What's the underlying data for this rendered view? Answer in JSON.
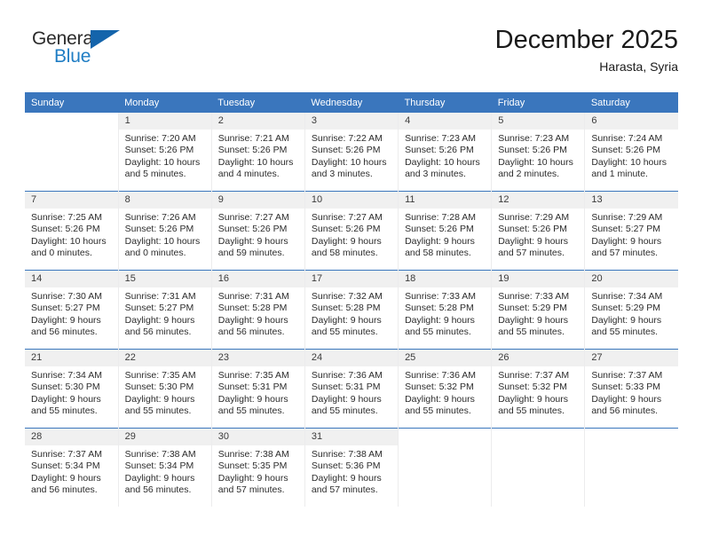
{
  "brand": {
    "name_part1": "General",
    "name_part2": "Blue",
    "triangle_color": "#1464ab",
    "blue_color": "#1f7dc4"
  },
  "header": {
    "title": "December 2025",
    "location": "Harasta, Syria",
    "header_bg": "#3a76bd",
    "daynum_bg": "#f0f0f0"
  },
  "weekdays": [
    "Sunday",
    "Monday",
    "Tuesday",
    "Wednesday",
    "Thursday",
    "Friday",
    "Saturday"
  ],
  "labels": {
    "sunrise": "Sunrise:",
    "sunset": "Sunset:",
    "daylight": "Daylight:"
  },
  "weeks": [
    [
      {
        "day": "",
        "sunrise": "",
        "sunset": "",
        "daylight": ""
      },
      {
        "day": "1",
        "sunrise": "Sunrise: 7:20 AM",
        "sunset": "Sunset: 5:26 PM",
        "daylight": "Daylight: 10 hours and 5 minutes."
      },
      {
        "day": "2",
        "sunrise": "Sunrise: 7:21 AM",
        "sunset": "Sunset: 5:26 PM",
        "daylight": "Daylight: 10 hours and 4 minutes."
      },
      {
        "day": "3",
        "sunrise": "Sunrise: 7:22 AM",
        "sunset": "Sunset: 5:26 PM",
        "daylight": "Daylight: 10 hours and 3 minutes."
      },
      {
        "day": "4",
        "sunrise": "Sunrise: 7:23 AM",
        "sunset": "Sunset: 5:26 PM",
        "daylight": "Daylight: 10 hours and 3 minutes."
      },
      {
        "day": "5",
        "sunrise": "Sunrise: 7:23 AM",
        "sunset": "Sunset: 5:26 PM",
        "daylight": "Daylight: 10 hours and 2 minutes."
      },
      {
        "day": "6",
        "sunrise": "Sunrise: 7:24 AM",
        "sunset": "Sunset: 5:26 PM",
        "daylight": "Daylight: 10 hours and 1 minute."
      }
    ],
    [
      {
        "day": "7",
        "sunrise": "Sunrise: 7:25 AM",
        "sunset": "Sunset: 5:26 PM",
        "daylight": "Daylight: 10 hours and 0 minutes."
      },
      {
        "day": "8",
        "sunrise": "Sunrise: 7:26 AM",
        "sunset": "Sunset: 5:26 PM",
        "daylight": "Daylight: 10 hours and 0 minutes."
      },
      {
        "day": "9",
        "sunrise": "Sunrise: 7:27 AM",
        "sunset": "Sunset: 5:26 PM",
        "daylight": "Daylight: 9 hours and 59 minutes."
      },
      {
        "day": "10",
        "sunrise": "Sunrise: 7:27 AM",
        "sunset": "Sunset: 5:26 PM",
        "daylight": "Daylight: 9 hours and 58 minutes."
      },
      {
        "day": "11",
        "sunrise": "Sunrise: 7:28 AM",
        "sunset": "Sunset: 5:26 PM",
        "daylight": "Daylight: 9 hours and 58 minutes."
      },
      {
        "day": "12",
        "sunrise": "Sunrise: 7:29 AM",
        "sunset": "Sunset: 5:26 PM",
        "daylight": "Daylight: 9 hours and 57 minutes."
      },
      {
        "day": "13",
        "sunrise": "Sunrise: 7:29 AM",
        "sunset": "Sunset: 5:27 PM",
        "daylight": "Daylight: 9 hours and 57 minutes."
      }
    ],
    [
      {
        "day": "14",
        "sunrise": "Sunrise: 7:30 AM",
        "sunset": "Sunset: 5:27 PM",
        "daylight": "Daylight: 9 hours and 56 minutes."
      },
      {
        "day": "15",
        "sunrise": "Sunrise: 7:31 AM",
        "sunset": "Sunset: 5:27 PM",
        "daylight": "Daylight: 9 hours and 56 minutes."
      },
      {
        "day": "16",
        "sunrise": "Sunrise: 7:31 AM",
        "sunset": "Sunset: 5:28 PM",
        "daylight": "Daylight: 9 hours and 56 minutes."
      },
      {
        "day": "17",
        "sunrise": "Sunrise: 7:32 AM",
        "sunset": "Sunset: 5:28 PM",
        "daylight": "Daylight: 9 hours and 55 minutes."
      },
      {
        "day": "18",
        "sunrise": "Sunrise: 7:33 AM",
        "sunset": "Sunset: 5:28 PM",
        "daylight": "Daylight: 9 hours and 55 minutes."
      },
      {
        "day": "19",
        "sunrise": "Sunrise: 7:33 AM",
        "sunset": "Sunset: 5:29 PM",
        "daylight": "Daylight: 9 hours and 55 minutes."
      },
      {
        "day": "20",
        "sunrise": "Sunrise: 7:34 AM",
        "sunset": "Sunset: 5:29 PM",
        "daylight": "Daylight: 9 hours and 55 minutes."
      }
    ],
    [
      {
        "day": "21",
        "sunrise": "Sunrise: 7:34 AM",
        "sunset": "Sunset: 5:30 PM",
        "daylight": "Daylight: 9 hours and 55 minutes."
      },
      {
        "day": "22",
        "sunrise": "Sunrise: 7:35 AM",
        "sunset": "Sunset: 5:30 PM",
        "daylight": "Daylight: 9 hours and 55 minutes."
      },
      {
        "day": "23",
        "sunrise": "Sunrise: 7:35 AM",
        "sunset": "Sunset: 5:31 PM",
        "daylight": "Daylight: 9 hours and 55 minutes."
      },
      {
        "day": "24",
        "sunrise": "Sunrise: 7:36 AM",
        "sunset": "Sunset: 5:31 PM",
        "daylight": "Daylight: 9 hours and 55 minutes."
      },
      {
        "day": "25",
        "sunrise": "Sunrise: 7:36 AM",
        "sunset": "Sunset: 5:32 PM",
        "daylight": "Daylight: 9 hours and 55 minutes."
      },
      {
        "day": "26",
        "sunrise": "Sunrise: 7:37 AM",
        "sunset": "Sunset: 5:32 PM",
        "daylight": "Daylight: 9 hours and 55 minutes."
      },
      {
        "day": "27",
        "sunrise": "Sunrise: 7:37 AM",
        "sunset": "Sunset: 5:33 PM",
        "daylight": "Daylight: 9 hours and 56 minutes."
      }
    ],
    [
      {
        "day": "28",
        "sunrise": "Sunrise: 7:37 AM",
        "sunset": "Sunset: 5:34 PM",
        "daylight": "Daylight: 9 hours and 56 minutes."
      },
      {
        "day": "29",
        "sunrise": "Sunrise: 7:38 AM",
        "sunset": "Sunset: 5:34 PM",
        "daylight": "Daylight: 9 hours and 56 minutes."
      },
      {
        "day": "30",
        "sunrise": "Sunrise: 7:38 AM",
        "sunset": "Sunset: 5:35 PM",
        "daylight": "Daylight: 9 hours and 57 minutes."
      },
      {
        "day": "31",
        "sunrise": "Sunrise: 7:38 AM",
        "sunset": "Sunset: 5:36 PM",
        "daylight": "Daylight: 9 hours and 57 minutes."
      },
      {
        "day": "",
        "sunrise": "",
        "sunset": "",
        "daylight": ""
      },
      {
        "day": "",
        "sunrise": "",
        "sunset": "",
        "daylight": ""
      },
      {
        "day": "",
        "sunrise": "",
        "sunset": "",
        "daylight": ""
      }
    ]
  ]
}
